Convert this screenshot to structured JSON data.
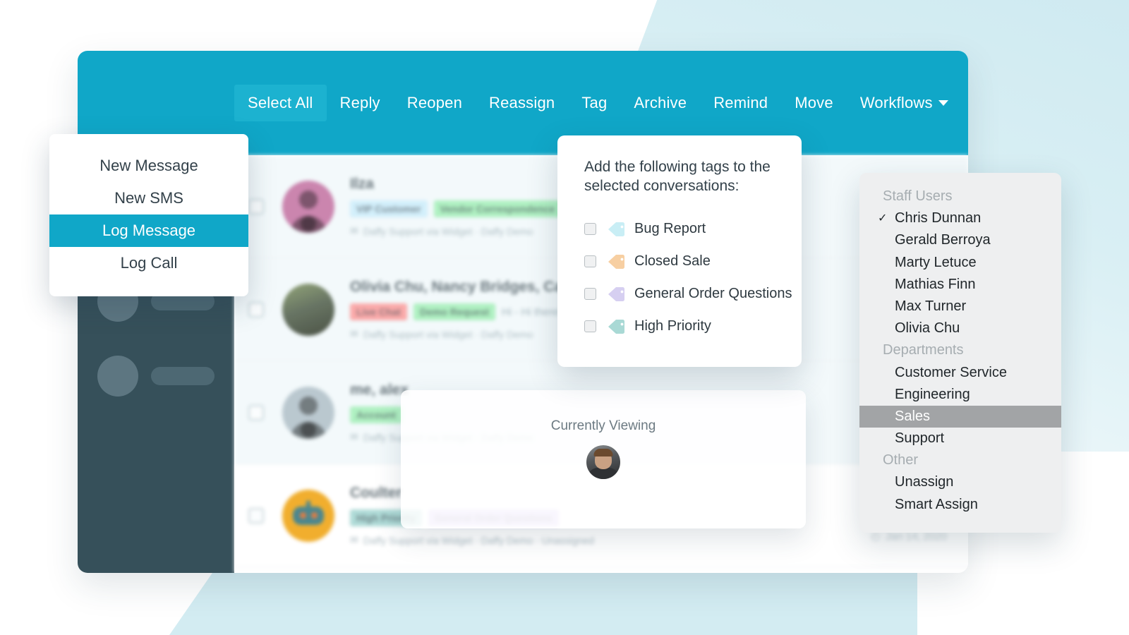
{
  "background": {
    "accent_color": "#10a7c8",
    "pale_blue": "#d3ecf2",
    "sidebar_color": "#36505a"
  },
  "toolbar": {
    "buttons": [
      {
        "label": "Select All",
        "active": true
      },
      {
        "label": "Reply",
        "active": false
      },
      {
        "label": "Reopen",
        "active": false
      },
      {
        "label": "Reassign",
        "active": false
      },
      {
        "label": "Tag",
        "active": false
      },
      {
        "label": "Archive",
        "active": false
      },
      {
        "label": "Remind",
        "active": false
      },
      {
        "label": "Move",
        "active": false
      },
      {
        "label": "Workflows",
        "active": false,
        "caret": true
      }
    ]
  },
  "compose_menu": {
    "items": [
      {
        "label": "New Message",
        "selected": false
      },
      {
        "label": "New SMS",
        "selected": false
      },
      {
        "label": "Log Message",
        "selected": true
      },
      {
        "label": "Log Call",
        "selected": false
      }
    ]
  },
  "tag_panel": {
    "title": "Add the following tags to the selected conversations:",
    "tags": [
      {
        "label": "Bug Report",
        "color": "#c9eef5",
        "checked": false
      },
      {
        "label": "Closed Sale",
        "color": "#f7cfa2",
        "checked": false
      },
      {
        "label": "General Order Questions",
        "color": "#d6cff1",
        "checked": false
      },
      {
        "label": "High Priority",
        "color": "#a9d9d5",
        "checked": false
      }
    ]
  },
  "viewing_panel": {
    "title": "Currently Viewing",
    "avatar_name": "chris-dunnan-avatar"
  },
  "assign_menu": {
    "sections": [
      {
        "group": "Staff Users",
        "items": [
          {
            "label": "Chris Dunnan",
            "checked": true,
            "selected": false
          },
          {
            "label": "Gerald Berroya",
            "checked": false,
            "selected": false
          },
          {
            "label": "Marty Letuce",
            "checked": false,
            "selected": false
          },
          {
            "label": "Mathias Finn",
            "checked": false,
            "selected": false
          },
          {
            "label": "Max Turner",
            "checked": false,
            "selected": false
          },
          {
            "label": "Olivia Chu",
            "checked": false,
            "selected": false
          }
        ]
      },
      {
        "group": "Departments",
        "items": [
          {
            "label": "Customer Service",
            "checked": false,
            "selected": false
          },
          {
            "label": "Engineering",
            "checked": false,
            "selected": false
          },
          {
            "label": "Sales",
            "checked": false,
            "selected": true
          },
          {
            "label": "Support",
            "checked": false,
            "selected": false
          }
        ]
      },
      {
        "group": "Other",
        "items": [
          {
            "label": "Unassign",
            "checked": false,
            "selected": false
          },
          {
            "label": "Smart Assign",
            "checked": false,
            "selected": false
          }
        ]
      }
    ]
  },
  "conversations": {
    "rows": [
      {
        "title": "Ilza",
        "avatar": "av-pink",
        "tags": [
          {
            "label": "VIP Customer",
            "bg": "#cfeefb"
          },
          {
            "label": "Vendor Correspondence",
            "bg": "#a9f0bd"
          }
        ],
        "subject": "",
        "meta": "Daffy Support via Widget  ·  Daffy Demo",
        "right": ""
      },
      {
        "title": "Olivia Chu, Nancy Bridges, Ca…",
        "avatar": "av-photo",
        "tags": [
          {
            "label": "Live Chat",
            "bg": "#fba3a3"
          },
          {
            "label": "Demo Request",
            "bg": "#a9f0bd"
          }
        ],
        "subject": "Hi - Hi there!",
        "meta": "Daffy Support via Widget  ·  Daffy Demo",
        "right": ""
      },
      {
        "title": "me, alex",
        "avatar": "av-grey",
        "tags": [
          {
            "label": "Account",
            "bg": "#a9f0bd"
          }
        ],
        "subject": "",
        "meta": "Daffy Support via Widget  ·  Daffy Demo",
        "right": ""
      },
      {
        "title": "Coulter",
        "avatar": "av-bot",
        "tags": [
          {
            "label": "High Priority",
            "bg": "#a9d9d5"
          },
          {
            "label": "General Order Questions",
            "bg": "#cdb9f4"
          }
        ],
        "subject": "",
        "meta": "Daffy Support via Widget  ·  Daffy Demo  ·  Unassigned",
        "right": "Jan 14, 2020"
      }
    ],
    "sidebar_placeholder_count": 3
  }
}
